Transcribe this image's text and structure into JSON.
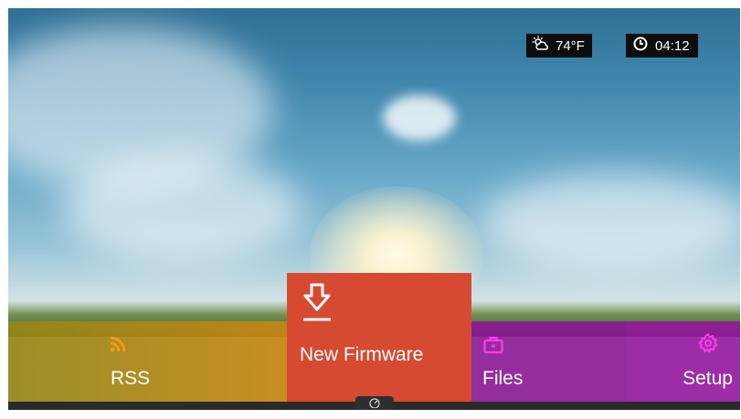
{
  "status": {
    "weather_icon": "partly-cloudy-icon",
    "temperature": "74°F",
    "clock_icon": "clock-icon",
    "time": "04:12"
  },
  "menu": {
    "items": [
      {
        "label": "RSS",
        "icon": "rss-icon",
        "color": "#b08a1a"
      },
      {
        "label": "New Firmware",
        "icon": "download-icon",
        "color": "#d64a32",
        "selected": true
      },
      {
        "label": "Files",
        "icon": "briefcase-icon",
        "color": "#e040e0"
      },
      {
        "label": "Setup",
        "icon": "gear-icon",
        "color": "#e040e0"
      }
    ]
  },
  "footer": {
    "icon": "speedometer-icon"
  }
}
